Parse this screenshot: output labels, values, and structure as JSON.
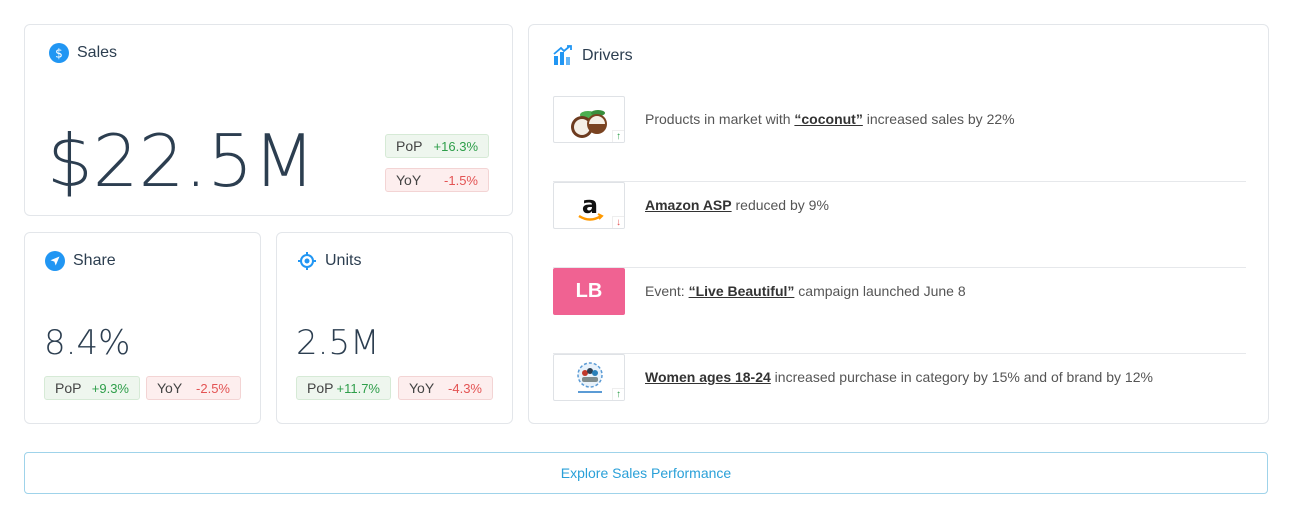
{
  "sales": {
    "title": "Sales",
    "value": "$22.5M",
    "pop_label": "PoP",
    "pop_value": "+16.3%",
    "yoy_label": "YoY",
    "yoy_value": "-1.5%"
  },
  "share": {
    "title": "Share",
    "value": "8.4%",
    "pop_label": "PoP",
    "pop_value": "+9.3%",
    "yoy_label": "YoY",
    "yoy_value": "-2.5%"
  },
  "units": {
    "title": "Units",
    "value": "2.5M",
    "pop_label": "PoP",
    "pop_value": "+11.7%",
    "yoy_label": "YoY",
    "yoy_value": "-4.3%"
  },
  "drivers": {
    "title": "Drivers",
    "items": [
      {
        "pre": "Products in market with ",
        "highlight": "“coconut”",
        "post": " increased sales by 22%",
        "trend": "up",
        "thumb_icon": "coconut-icon"
      },
      {
        "pre": "",
        "highlight": "Amazon ASP",
        "post": " reduced by 9%",
        "trend": "down",
        "thumb_icon": "amazon-logo-icon"
      },
      {
        "pre": "Event: ",
        "highlight": "“Live Beautiful”",
        "post": " campaign launched June 8",
        "trend": "none",
        "thumb_text": "LB"
      },
      {
        "pre": "",
        "highlight": "Women ages 18-24",
        "post": " increased purchase in category by 15% and of brand by 12%",
        "trend": "up",
        "thumb_icon": "audience-group-icon"
      }
    ]
  },
  "explore_label": "Explore Sales Performance",
  "colors": {
    "accent": "#2196f3",
    "positive": "#2e9e4a",
    "negative": "#e35353",
    "lb_tile": "#f06292"
  }
}
